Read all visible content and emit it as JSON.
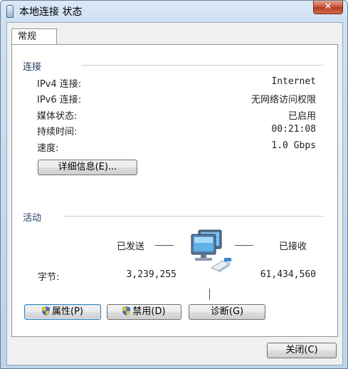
{
  "window": {
    "title": "本地连接 状态",
    "close_label": "✕"
  },
  "tab": {
    "label": "常规"
  },
  "connection": {
    "group_label": "连接",
    "rows": [
      {
        "label": "IPv4 连接:",
        "value": "Internet"
      },
      {
        "label": "IPv6 连接:",
        "value": "无网络访问权限"
      },
      {
        "label": "媒体状态:",
        "value": "已启用"
      },
      {
        "label": "持续时间:",
        "value": "00:21:08"
      },
      {
        "label": "速度:",
        "value": "1.0 Gbps"
      }
    ],
    "details_button": "详细信息(E)..."
  },
  "activity": {
    "group_label": "活动",
    "sent_label": "已发送",
    "received_label": "已接收",
    "bytes_label": "字节:",
    "bytes_sent": "3,239,255",
    "bytes_received": "61,434,560"
  },
  "buttons": {
    "properties": "属性(P)",
    "disable": "禁用(D)",
    "diagnose": "诊断(G)",
    "close": "关闭(C)"
  }
}
